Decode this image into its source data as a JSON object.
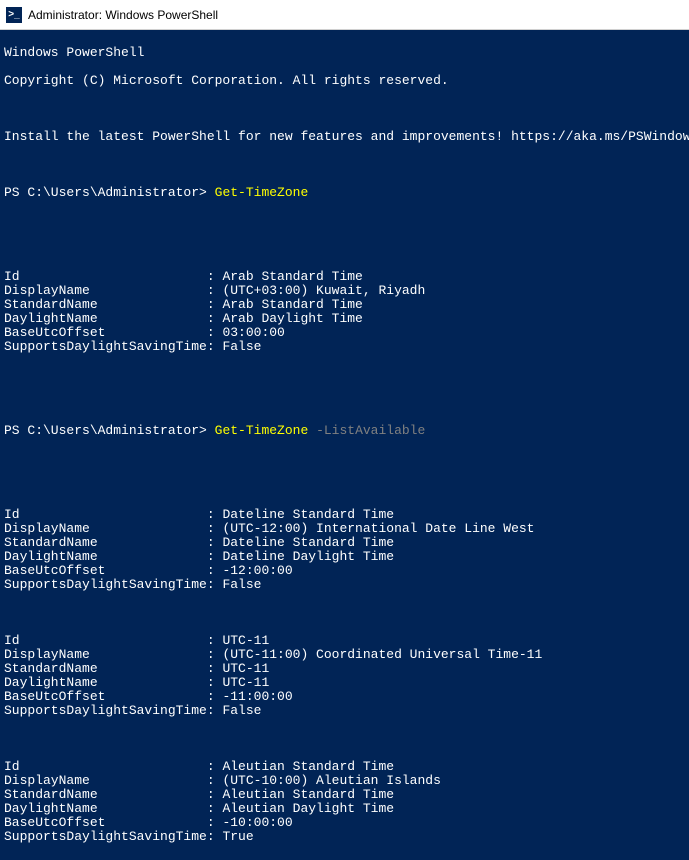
{
  "titlebar": {
    "title": "Administrator: Windows PowerShell"
  },
  "header": {
    "line1": "Windows PowerShell",
    "line2": "Copyright (C) Microsoft Corporation. All rights reserved.",
    "install": "Install the latest PowerShell for new features and improvements! https://aka.ms/PSWindows"
  },
  "prompt_text": "PS C:\\Users\\Administrator> ",
  "commands": {
    "cmd1": "Get-TimeZone",
    "cmd2": "Get-TimeZone",
    "cmd2_param": " -ListAvailable"
  },
  "blocks": [
    {
      "Id": "Arab Standard Time",
      "DisplayName": "(UTC+03:00) Kuwait, Riyadh",
      "StandardName": "Arab Standard Time",
      "DaylightName": "Arab Daylight Time",
      "BaseUtcOffset": "03:00:00",
      "SupportsDaylightSavingTime": "False"
    },
    {
      "Id": "Dateline Standard Time",
      "DisplayName": "(UTC-12:00) International Date Line West",
      "StandardName": "Dateline Standard Time",
      "DaylightName": "Dateline Daylight Time",
      "BaseUtcOffset": "-12:00:00",
      "SupportsDaylightSavingTime": "False"
    },
    {
      "Id": "UTC-11",
      "DisplayName": "(UTC-11:00) Coordinated Universal Time-11",
      "StandardName": "UTC-11",
      "DaylightName": "UTC-11",
      "BaseUtcOffset": "-11:00:00",
      "SupportsDaylightSavingTime": "False"
    },
    {
      "Id": "Aleutian Standard Time",
      "DisplayName": "(UTC-10:00) Aleutian Islands",
      "StandardName": "Aleutian Standard Time",
      "DaylightName": "Aleutian Daylight Time",
      "BaseUtcOffset": "-10:00:00",
      "SupportsDaylightSavingTime": "True"
    }
  ],
  "property_keys": [
    "Id",
    "DisplayName",
    "StandardName",
    "DaylightName",
    "BaseUtcOffset",
    "SupportsDaylightSavingTime"
  ]
}
